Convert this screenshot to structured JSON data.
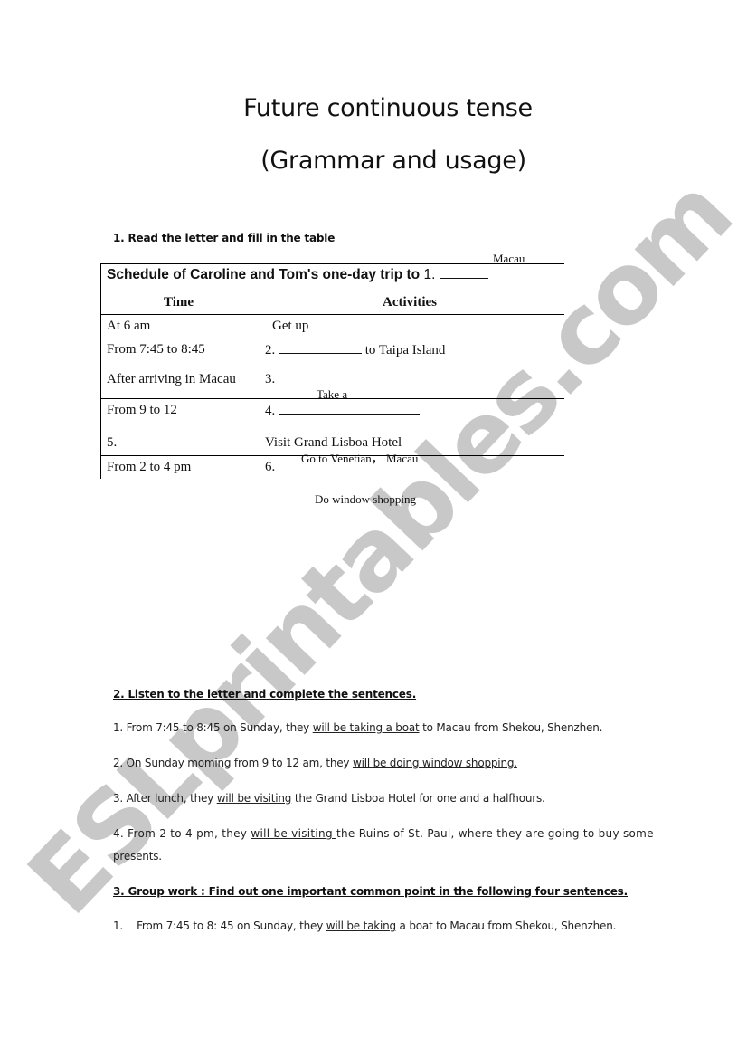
{
  "document": {
    "title_line1": "Future continuous tense",
    "title_line2": "(Grammar and usage)"
  },
  "watermark": {
    "text": "ESLprintables.com",
    "color": "#bfbfbf"
  },
  "section1": {
    "heading": "1. Read the letter and fill in the table",
    "table": {
      "title_bold": "Schedule of Caroline and Tom's one-day trip to",
      "title_blank_prefix": "1.",
      "answer_overlay_1": "Macau",
      "headers": [
        "Time",
        "Activities"
      ],
      "rows": [
        {
          "time": "At 6 am",
          "activity": "Get up"
        },
        {
          "time": "From 7:45 to 8:45",
          "activity_prefix": "2.",
          "activity_suffix": "to  Taipa Island"
        },
        {
          "time": "After arriving in Macau",
          "activity": "3."
        },
        {
          "time": "From 9 to 12",
          "activity": "4."
        },
        {
          "time": "5.",
          "activity": "Visit Grand Lisboa Hotel"
        },
        {
          "time": "From 2 to 4 pm",
          "activity": "6."
        }
      ],
      "answer_overlays": {
        "answer_2": "Take a",
        "answer_3": "Go to Venetian， Macau",
        "answer_4": "Do window shopping"
      }
    }
  },
  "section2": {
    "heading": "2. Listen to the letter and complete the sentences.",
    "sentences": [
      {
        "before": "1. From 7:45 to 8:45 on Sunday, they ",
        "underlined": "will be taking a boat",
        "after": " to Macau from Shekou, Shenzhen."
      },
      {
        "before": "2. On Sunday moming from 9 to 12 am, they ",
        "underlined": "will be doing window shopping.",
        "after": ""
      },
      {
        "before": "3. After lunch, they ",
        "underlined": "will be visiting",
        "after": " the Grand Lisboa Hotel for one and a halfhours."
      },
      {
        "before": "4. From 2 to 4 pm, they ",
        "underlined": "will be visiting ",
        "after": "the Ruins of St. Paul, where they are going to buy some"
      },
      {
        "before": "presents.",
        "underlined": "",
        "after": ""
      }
    ]
  },
  "section3": {
    "heading": "3. Group work : Find out one important common point in the following four sentences.",
    "items": [
      {
        "number": "1.",
        "before": "From 7:45 to 8: 45 on Sunday, they ",
        "underlined": "will be taking",
        "after": " a boat to Macau from Shekou, Shenzhen."
      }
    ]
  }
}
